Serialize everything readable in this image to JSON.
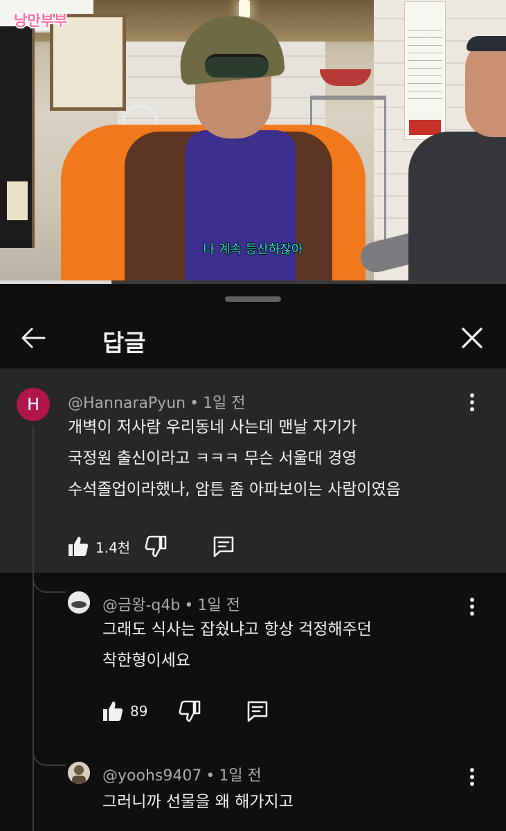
{
  "video": {
    "channel_logo": "낭만부부",
    "subtitle": "나 계속 등산하잖아",
    "progress_fraction": 0.22
  },
  "sheet": {
    "title": "답글",
    "back_icon": "arrow-left-icon",
    "close_icon": "close-icon"
  },
  "comments": [
    {
      "avatar_letter": "H",
      "avatar_color": "#b0164c",
      "author": "@HannaraPyun",
      "time": "1일 전",
      "lines": [
        "개벽이 저사람 우리동네 사는데 맨날 자기가",
        "국정원 출신이라고 ㅋㅋㅋ 무슨  서울대 경영",
        "수석졸업이라했나, 암튼 좀 아파보이는 사람이였음"
      ],
      "likes": "1.4천"
    },
    {
      "author": "@금왕-q4b",
      "time": "1일 전",
      "lines": [
        "그래도 식사는 잡쉈냐고 항상 걱정해주던",
        "착한형이세요"
      ],
      "likes": "89"
    },
    {
      "author": "@yoohs9407",
      "time": "1일 전",
      "lines": [
        "그러니까 선물을 왜 해가지고"
      ]
    }
  ],
  "colors": {
    "background": "#0f0f0f",
    "highlight_comment": "#272727",
    "secondary_text": "#aaaaaa",
    "subtitle_color": "#39e6e2"
  }
}
